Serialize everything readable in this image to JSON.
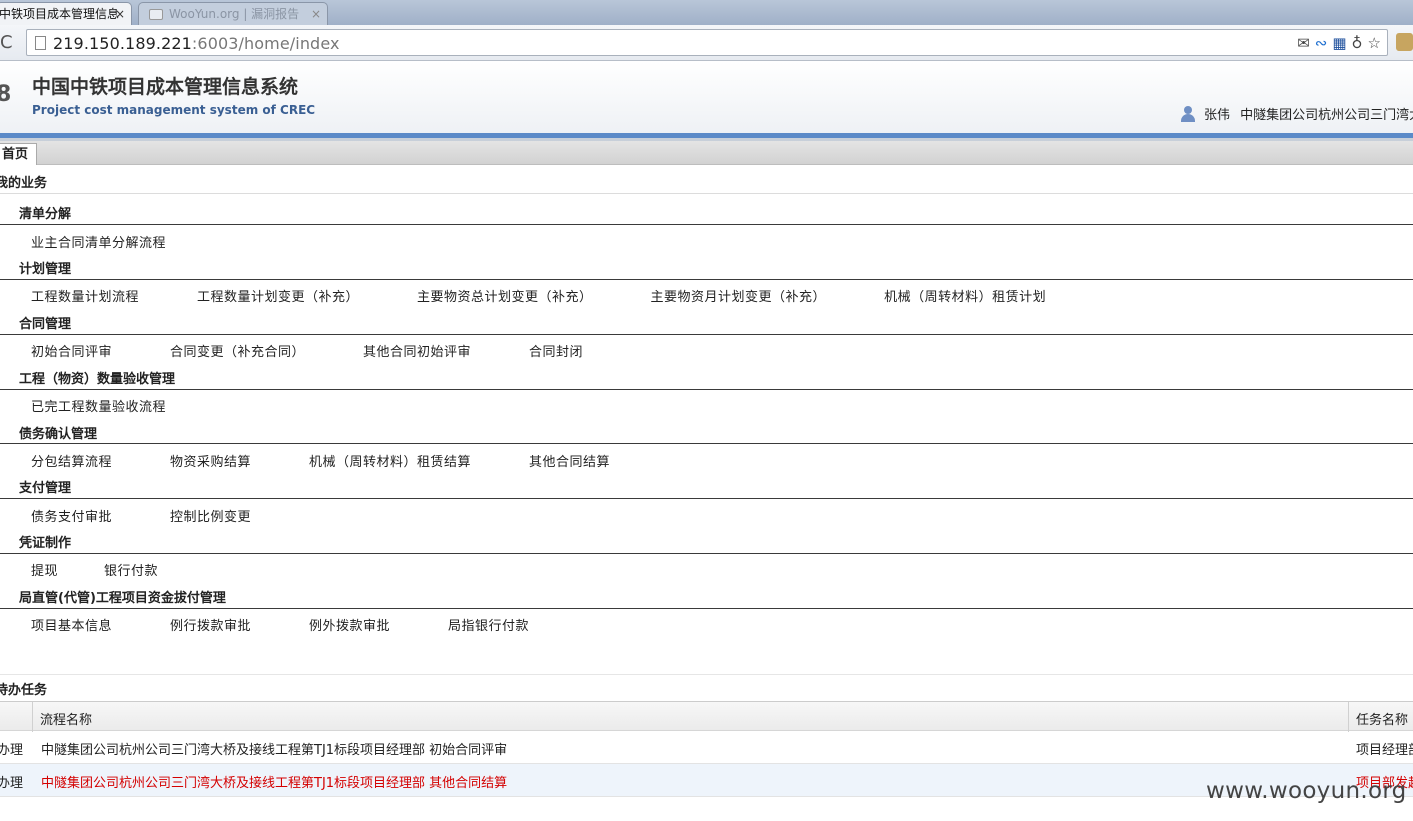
{
  "browser": {
    "active_tab": "中铁项目成本管理信息",
    "inactive_tab": "WooYun.org | 漏洞报告",
    "tab_close": "×",
    "reload_glyph": "C",
    "url_host": "219.150.189.221",
    "url_rest": ":6003/home/index",
    "star_glyph": "☆"
  },
  "header": {
    "logo_fragment": "8",
    "title": "中国中铁项目成本管理信息系统",
    "subtitle": "Project cost management system of CREC",
    "user_name": "张伟",
    "user_org": "中隧集团公司杭州公司三门湾大"
  },
  "page_tabs": [
    {
      "label": "首页"
    }
  ],
  "business": {
    "heading": "我的业务",
    "groups": [
      {
        "title": "清单分解",
        "links": [
          "业主合同清单分解流程"
        ]
      },
      {
        "title": "计划管理",
        "links": [
          "工程数量计划流程",
          "工程数量计划变更（补充）",
          "主要物资总计划变更（补充）",
          "主要物资月计划变更（补充）",
          "机械（周转材料）租赁计划"
        ]
      },
      {
        "title": "合同管理",
        "links": [
          "初始合同评审",
          "合同变更（补充合同）",
          "其他合同初始评审",
          "合同封闭"
        ]
      },
      {
        "title": "工程（物资）数量验收管理",
        "links": [
          "已完工程数量验收流程"
        ]
      },
      {
        "title": "债务确认管理",
        "links": [
          "分包结算流程",
          "物资采购结算",
          "机械（周转材料）租赁结算",
          "其他合同结算"
        ]
      },
      {
        "title": "支付管理",
        "links": [
          "债务支付审批",
          "控制比例变更"
        ]
      },
      {
        "title": "凭证制作",
        "links": [
          "提现",
          "银行付款"
        ]
      },
      {
        "title": "局直管(代管)工程项目资金拔付管理",
        "links": [
          "项目基本信息",
          "例行拨款审批",
          "例外拨款审批",
          "局指银行付款"
        ]
      }
    ]
  },
  "todo": {
    "heading": "待办任务",
    "columns": {
      "flow_name": "流程名称",
      "task_name": "任务名称"
    },
    "rows": [
      {
        "action": "办理",
        "flow": "中隧集团公司杭州公司三门湾大桥及接线工程第TJ1标段项目经理部 初始合同评审",
        "task": "项目经理部",
        "highlight": false
      },
      {
        "action": "办理",
        "flow": "中隧集团公司杭州公司三门湾大桥及接线工程第TJ1标段项目经理部 其他合同结算",
        "task": "项目部发起",
        "highlight": true
      }
    ]
  },
  "watermark": "www.wooyun.org",
  "colors": {
    "accent": "#5b8ac8",
    "highlight_text": "#d40000",
    "subtitle": "#3a5f93"
  }
}
